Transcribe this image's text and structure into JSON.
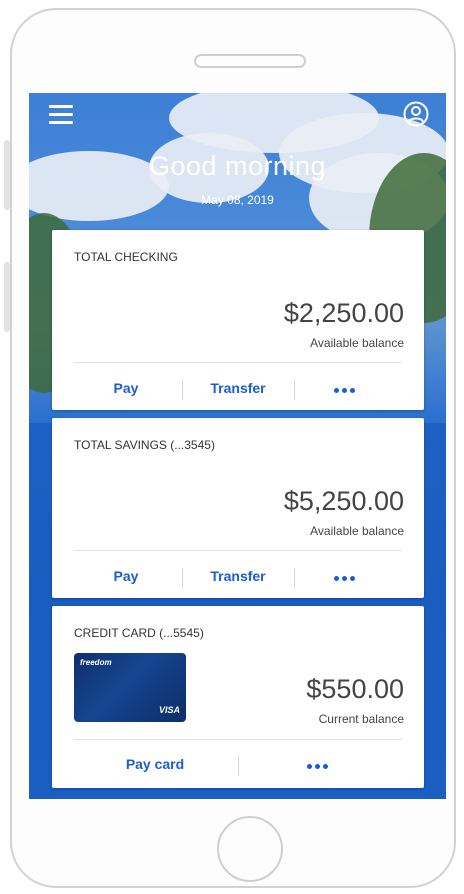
{
  "header": {
    "greeting": "Good morning",
    "date": "May 08, 2019"
  },
  "accounts": [
    {
      "title": "TOTAL CHECKING",
      "amount": "$2,250.00",
      "amount_label": "Available balance",
      "actions": {
        "primary": "Pay",
        "secondary": "Transfer"
      }
    },
    {
      "title": "TOTAL SAVINGS (...3545)",
      "amount": "$5,250.00",
      "amount_label": "Available balance",
      "actions": {
        "primary": "Pay",
        "secondary": "Transfer"
      }
    },
    {
      "title": "CREDIT CARD (...5545)",
      "amount": "$550.00",
      "amount_label": "Current balance",
      "card_image": {
        "brand": "freedom",
        "network": "VISA"
      },
      "actions": {
        "primary": "Pay card"
      }
    }
  ],
  "icons": {
    "menu": "menu-icon",
    "profile": "user-profile-icon",
    "more": "more-options-icon"
  },
  "colors": {
    "accent": "#1a5dd6",
    "screen_background": "#1e63c6",
    "card_background": "#ffffff"
  }
}
